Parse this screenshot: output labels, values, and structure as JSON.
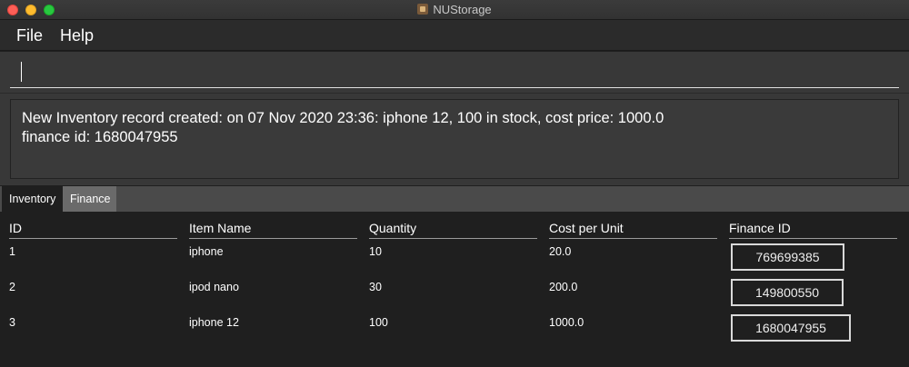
{
  "window": {
    "title": "NUStorage"
  },
  "menu": {
    "file": "File",
    "help": "Help"
  },
  "command": {
    "value": "",
    "placeholder": ""
  },
  "result": {
    "line1": "New Inventory record created: on 07 Nov 2020 23:36: iphone 12, 100 in stock, cost price: 1000.0",
    "line2": "finance id: 1680047955"
  },
  "tabs": [
    {
      "label": "Inventory",
      "selected": true
    },
    {
      "label": "Finance",
      "selected": false
    }
  ],
  "table": {
    "headers": [
      "ID",
      "Item Name",
      "Quantity",
      "Cost per Unit",
      "Finance ID"
    ],
    "rows": [
      {
        "id": "1",
        "name": "iphone",
        "quantity": "10",
        "cost": "20.0",
        "finance_id": "769699385"
      },
      {
        "id": "2",
        "name": "ipod nano",
        "quantity": "30",
        "cost": "200.0",
        "finance_id": "149800550"
      },
      {
        "id": "3",
        "name": "iphone 12",
        "quantity": "100",
        "cost": "1000.0",
        "finance_id": "1680047955"
      }
    ]
  },
  "colors": {
    "close": "#fe5f57",
    "minimize": "#febc2e",
    "maximize": "#28c840",
    "background": "#1f1f1f",
    "panel": "#383838"
  }
}
